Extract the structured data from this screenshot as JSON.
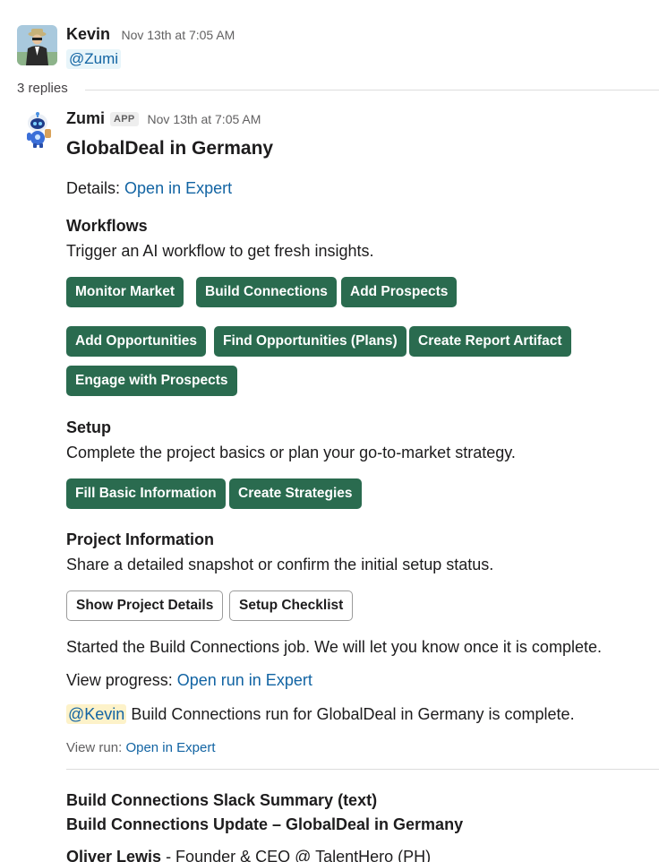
{
  "message1": {
    "sender": "Kevin",
    "timestamp": "Nov 13th at 7:05 AM",
    "mention": "@Zumi"
  },
  "thread": {
    "replies": "3 replies"
  },
  "message2": {
    "sender": "Zumi",
    "badge": "APP",
    "timestamp": "Nov 13th at 7:05 AM",
    "title": "GlobalDeal in Germany",
    "details_label": "Details:",
    "details_link": "Open in Expert",
    "workflows": {
      "title": "Workflows",
      "description": "Trigger an AI workflow to get fresh insights.",
      "buttons": [
        "Monitor Market",
        "Build Connections",
        "Add Prospects",
        "Add Opportunities",
        "Find Opportunities (Plans)",
        "Create Report Artifact",
        "Engage with Prospects"
      ]
    },
    "setup": {
      "title": "Setup",
      "description": "Complete the project basics or plan your go-to-market strategy.",
      "buttons": [
        "Fill Basic Information",
        "Create Strategies"
      ]
    },
    "project_info": {
      "title": "Project Information",
      "description": "Share a detailed snapshot or confirm the initial setup status.",
      "buttons": [
        "Show Project Details",
        "Setup Checklist"
      ]
    },
    "status": "Started the Build Connections job. We will let you know once it is complete.",
    "progress_label": "View progress:",
    "progress_link": "Open run in Expert",
    "completion_mention": "@Kevin",
    "completion_text": "Build Connections run for GlobalDeal in Germany is complete.",
    "view_run_label": "View run:",
    "view_run_link": "Open in Expert",
    "summary_title": "Build Connections Slack Summary (text)",
    "summary_subtitle": "Build Connections Update – GlobalDeal in Germany",
    "contact_name": "Oliver Lewis",
    "contact_role": " - Founder & CEO @ TalentHero (PH)"
  }
}
